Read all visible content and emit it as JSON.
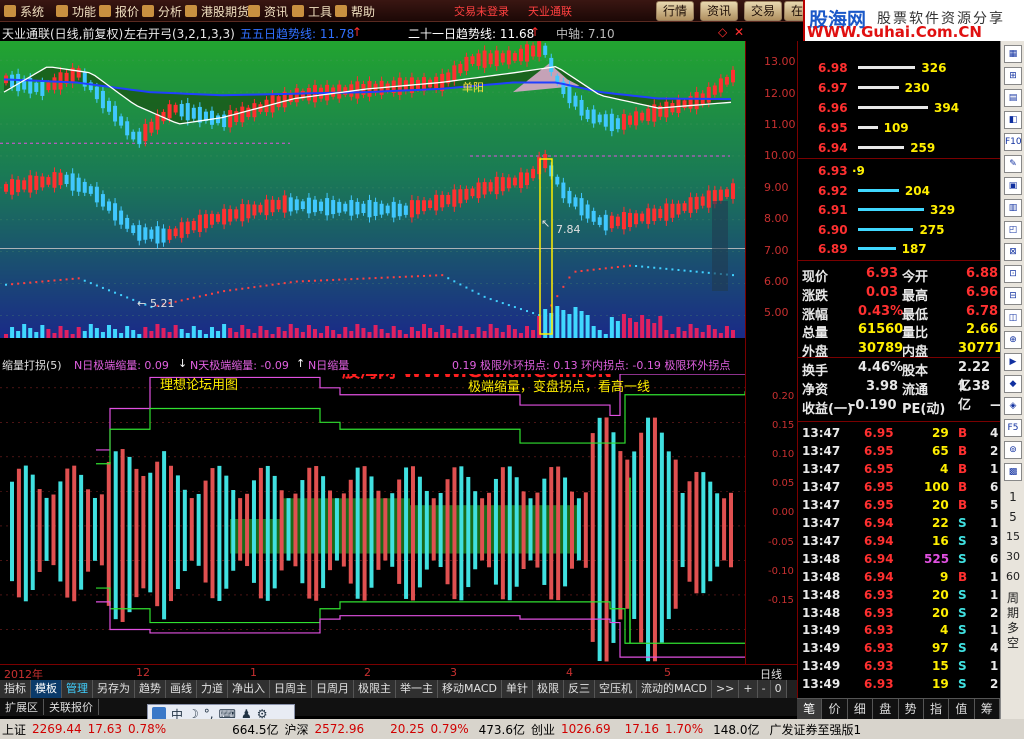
{
  "menu": {
    "items": [
      "系统",
      "功能",
      "报价",
      "分析",
      "港股期货",
      "资讯",
      "工具",
      "帮助"
    ],
    "red_links": [
      "交易未登录",
      "天业通联"
    ],
    "buttons": [
      "行情",
      "资讯",
      "交易",
      "在"
    ]
  },
  "logo": {
    "name": "股海网",
    "url": "WWW.Guhai.Com.CN",
    "slogan": "股票软件资源分享"
  },
  "price_panel": {
    "stock": "天业通联(日线,前复权)",
    "indicator": "左右开弓(3,2,1,3,3)",
    "line5": "五五日趋势线: 11.78",
    "line21": "二十一日趋势线: 11.68",
    "mid": "中轴: 7.10",
    "label_mid": "7.84",
    "label_low": "5.21",
    "label_yang": "单阳"
  },
  "ind_panel": {
    "name": "缩量打拐(5)",
    "n_day": "N日极端缩量: 0.09",
    "n_sky": "N天极端缩量: -0.09",
    "n_min": "N日缩量",
    "tail": "0.19  极限外环拐点: 0.13  环内拐点: -0.19  极限环外拐点",
    "title_left": "理想论坛用图",
    "title_right": "极端缩量，变盘拐点，看高一线",
    "watermark": "股海网 WWW.Guhai.Com.CN"
  },
  "y_axis_price": [
    "13.00",
    "12.00",
    "11.00",
    "10.00",
    "9.00",
    "8.00",
    "7.00",
    "6.00",
    "5.00"
  ],
  "y_axis_ind": [
    "0.20",
    "0.15",
    "0.10",
    "0.05",
    "0.00",
    "-0.05",
    "-0.10",
    "-0.15"
  ],
  "x_axis": {
    "year": "2012年",
    "months": [
      "12",
      "1",
      "2",
      "3",
      "4",
      "5",
      "6"
    ],
    "period": "日线"
  },
  "bottom_tabs": [
    "指标",
    "模板",
    "管理",
    "另存为",
    "趋势",
    "画线",
    "力道",
    "净出入",
    "日周主",
    "日周月",
    "极限主",
    "举一主",
    "移动MACD",
    "单针",
    "极限",
    "反三",
    "空压机",
    "流动的MACD",
    ">>",
    "+",
    "-",
    "0"
  ],
  "ext_tabs": [
    "扩展区",
    "关联报价"
  ],
  "ime": {
    "items": [
      "中",
      "☽",
      "°,",
      "⌨",
      "♟",
      "⚙"
    ]
  },
  "status": {
    "sh_label": "上证",
    "sh_val": "2269.44",
    "sh_chg": "17.63",
    "sh_pct": "0.78%",
    "sh_amt": "664.5亿",
    "hs_label": "沪深",
    "hs_val": "2572.96",
    "hs_chg": "20.25",
    "hs_pct": "0.79%",
    "hs_amt": "473.6亿",
    "cy_label": "创业",
    "cy_val": "1026.69",
    "cy_chg": "17.16",
    "cy_pct": "1.70%",
    "cy_amt": "148.0亿",
    "broker": "广发证券至强版1"
  },
  "sell_orders": [
    {
      "p": "6.98",
      "q": "326",
      "w": 0.82
    },
    {
      "p": "6.97",
      "q": "230",
      "w": 0.58
    },
    {
      "p": "6.96",
      "q": "394",
      "w": 1.0
    },
    {
      "p": "6.95",
      "q": "109",
      "w": 0.28
    },
    {
      "p": "6.94",
      "q": "259",
      "w": 0.66
    }
  ],
  "buy_orders": [
    {
      "p": "6.93",
      "q": "9",
      "w": 0.03
    },
    {
      "p": "6.92",
      "q": "204",
      "w": 0.62
    },
    {
      "p": "6.91",
      "q": "329",
      "w": 1.0
    },
    {
      "p": "6.90",
      "q": "275",
      "w": 0.84
    },
    {
      "p": "6.89",
      "q": "187",
      "w": 0.57
    }
  ],
  "quote": [
    {
      "l1": "现价",
      "v1": "6.93",
      "l2": "今开",
      "v2": "6.88"
    },
    {
      "l1": "涨跌",
      "v1": "0.03",
      "l2": "最高",
      "v2": "6.96"
    },
    {
      "l1": "涨幅",
      "v1": "0.43%",
      "l2": "最低",
      "v2": "6.78"
    },
    {
      "l1": "总量",
      "v1": "61560",
      "l2": "量比",
      "v2": "2.66"
    },
    {
      "l1": "外盘",
      "v1": "30789",
      "l2": "内盘",
      "v2": "30771"
    },
    {
      "l1": "换手",
      "v1": "4.46%",
      "l2": "股本",
      "v2": "2.22亿"
    },
    {
      "l1": "净资",
      "v1": "3.98",
      "l2": "流通",
      "v2": "1.38亿"
    },
    {
      "l1": "收益(一)",
      "v1": "-0.190",
      "l2": "PE(动)",
      "v2": "—"
    }
  ],
  "trades": [
    {
      "t": "13:47",
      "p": "6.95",
      "v": "29",
      "s": "B",
      "n": "4"
    },
    {
      "t": "13:47",
      "p": "6.95",
      "v": "65",
      "s": "B",
      "n": "2"
    },
    {
      "t": "13:47",
      "p": "6.95",
      "v": "4",
      "s": "B",
      "n": "1"
    },
    {
      "t": "13:47",
      "p": "6.95",
      "v": "100",
      "s": "B",
      "n": "6"
    },
    {
      "t": "13:47",
      "p": "6.95",
      "v": "20",
      "s": "B",
      "n": "5"
    },
    {
      "t": "13:47",
      "p": "6.94",
      "v": "22",
      "s": "S",
      "n": "1"
    },
    {
      "t": "13:47",
      "p": "6.94",
      "v": "16",
      "s": "S",
      "n": "3"
    },
    {
      "t": "13:48",
      "p": "6.94",
      "v": "525",
      "s": "S",
      "n": "6"
    },
    {
      "t": "13:48",
      "p": "6.94",
      "v": "9",
      "s": "B",
      "n": "1"
    },
    {
      "t": "13:48",
      "p": "6.93",
      "v": "20",
      "s": "S",
      "n": "1"
    },
    {
      "t": "13:48",
      "p": "6.93",
      "v": "20",
      "s": "S",
      "n": "2"
    },
    {
      "t": "13:49",
      "p": "6.93",
      "v": "4",
      "s": "S",
      "n": "1"
    },
    {
      "t": "13:49",
      "p": "6.93",
      "v": "97",
      "s": "S",
      "n": "4"
    },
    {
      "t": "13:49",
      "p": "6.93",
      "v": "15",
      "s": "S",
      "n": "1"
    },
    {
      "t": "13:49",
      "p": "6.93",
      "v": "19",
      "s": "S",
      "n": "2"
    }
  ],
  "side_tabs": [
    "笔",
    "价",
    "细",
    "盘",
    "势",
    "指",
    "值",
    "筹"
  ],
  "toolstrip": {
    "icons": [
      "F10",
      "F5"
    ],
    "vertical": "周期多空"
  },
  "colors": {
    "up": "#ff3030",
    "down": "#40c8ff",
    "ma_fill": "#1a5a1a",
    "bg_top": "#22a030",
    "bg_bottom": "#1a2a80",
    "ind_pink": "#e050e0",
    "ind_green": "#30e030",
    "bar_up": "#e05050",
    "bar_down": "#40e0e0"
  },
  "chart_data": [
    {
      "type": "candlestick",
      "title": "天业通联(日线,前复权)",
      "ylim": [
        4.3,
        13.6
      ],
      "ylabels": [
        "13.00",
        "12.00",
        "11.00",
        "10.00",
        "9.00",
        "8.00",
        "7.00",
        "6.00",
        "5.00"
      ],
      "series": [
        {
          "name": "五五日趋势线",
          "values": [
            11.78
          ]
        },
        {
          "name": "二十一日趋势线",
          "values": [
            11.68
          ]
        }
      ],
      "mid": 7.1,
      "annotations": [
        "单阳",
        "7.84",
        "5.21"
      ]
    },
    {
      "type": "bar",
      "title": "缩量打拐(5)",
      "ylim": [
        -0.2,
        0.22
      ],
      "ylabels": [
        "0.20",
        "0.15",
        "0.10",
        "0.05",
        "0.00",
        "-0.05",
        "-0.10",
        "-0.15"
      ],
      "series": [
        {
          "name": "N日极端缩量",
          "values": [
            0.09
          ]
        },
        {
          "name": "N天极端缩量",
          "values": [
            -0.09
          ]
        }
      ]
    }
  ]
}
